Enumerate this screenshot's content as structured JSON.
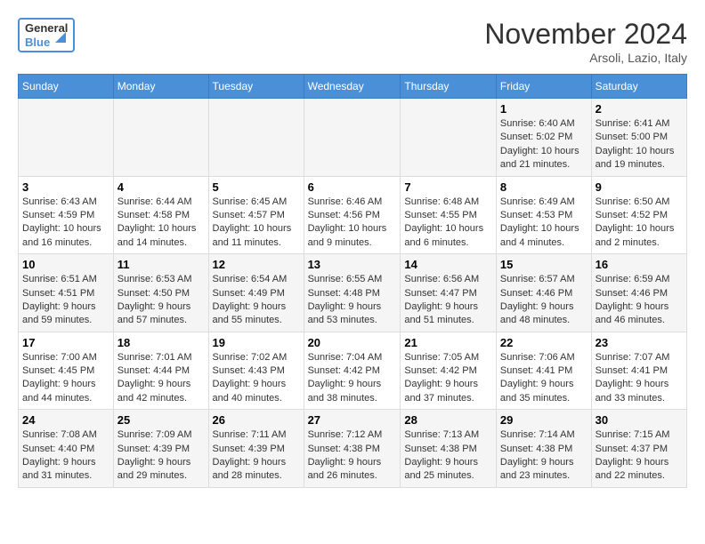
{
  "header": {
    "logo_line1": "General",
    "logo_line2": "Blue",
    "month_title": "November 2024",
    "location": "Arsoli, Lazio, Italy"
  },
  "weekdays": [
    "Sunday",
    "Monday",
    "Tuesday",
    "Wednesday",
    "Thursday",
    "Friday",
    "Saturday"
  ],
  "weeks": [
    [
      {
        "day": "",
        "info": ""
      },
      {
        "day": "",
        "info": ""
      },
      {
        "day": "",
        "info": ""
      },
      {
        "day": "",
        "info": ""
      },
      {
        "day": "",
        "info": ""
      },
      {
        "day": "1",
        "info": "Sunrise: 6:40 AM\nSunset: 5:02 PM\nDaylight: 10 hours and 21 minutes."
      },
      {
        "day": "2",
        "info": "Sunrise: 6:41 AM\nSunset: 5:00 PM\nDaylight: 10 hours and 19 minutes."
      }
    ],
    [
      {
        "day": "3",
        "info": "Sunrise: 6:43 AM\nSunset: 4:59 PM\nDaylight: 10 hours and 16 minutes."
      },
      {
        "day": "4",
        "info": "Sunrise: 6:44 AM\nSunset: 4:58 PM\nDaylight: 10 hours and 14 minutes."
      },
      {
        "day": "5",
        "info": "Sunrise: 6:45 AM\nSunset: 4:57 PM\nDaylight: 10 hours and 11 minutes."
      },
      {
        "day": "6",
        "info": "Sunrise: 6:46 AM\nSunset: 4:56 PM\nDaylight: 10 hours and 9 minutes."
      },
      {
        "day": "7",
        "info": "Sunrise: 6:48 AM\nSunset: 4:55 PM\nDaylight: 10 hours and 6 minutes."
      },
      {
        "day": "8",
        "info": "Sunrise: 6:49 AM\nSunset: 4:53 PM\nDaylight: 10 hours and 4 minutes."
      },
      {
        "day": "9",
        "info": "Sunrise: 6:50 AM\nSunset: 4:52 PM\nDaylight: 10 hours and 2 minutes."
      }
    ],
    [
      {
        "day": "10",
        "info": "Sunrise: 6:51 AM\nSunset: 4:51 PM\nDaylight: 9 hours and 59 minutes."
      },
      {
        "day": "11",
        "info": "Sunrise: 6:53 AM\nSunset: 4:50 PM\nDaylight: 9 hours and 57 minutes."
      },
      {
        "day": "12",
        "info": "Sunrise: 6:54 AM\nSunset: 4:49 PM\nDaylight: 9 hours and 55 minutes."
      },
      {
        "day": "13",
        "info": "Sunrise: 6:55 AM\nSunset: 4:48 PM\nDaylight: 9 hours and 53 minutes."
      },
      {
        "day": "14",
        "info": "Sunrise: 6:56 AM\nSunset: 4:47 PM\nDaylight: 9 hours and 51 minutes."
      },
      {
        "day": "15",
        "info": "Sunrise: 6:57 AM\nSunset: 4:46 PM\nDaylight: 9 hours and 48 minutes."
      },
      {
        "day": "16",
        "info": "Sunrise: 6:59 AM\nSunset: 4:46 PM\nDaylight: 9 hours and 46 minutes."
      }
    ],
    [
      {
        "day": "17",
        "info": "Sunrise: 7:00 AM\nSunset: 4:45 PM\nDaylight: 9 hours and 44 minutes."
      },
      {
        "day": "18",
        "info": "Sunrise: 7:01 AM\nSunset: 4:44 PM\nDaylight: 9 hours and 42 minutes."
      },
      {
        "day": "19",
        "info": "Sunrise: 7:02 AM\nSunset: 4:43 PM\nDaylight: 9 hours and 40 minutes."
      },
      {
        "day": "20",
        "info": "Sunrise: 7:04 AM\nSunset: 4:42 PM\nDaylight: 9 hours and 38 minutes."
      },
      {
        "day": "21",
        "info": "Sunrise: 7:05 AM\nSunset: 4:42 PM\nDaylight: 9 hours and 37 minutes."
      },
      {
        "day": "22",
        "info": "Sunrise: 7:06 AM\nSunset: 4:41 PM\nDaylight: 9 hours and 35 minutes."
      },
      {
        "day": "23",
        "info": "Sunrise: 7:07 AM\nSunset: 4:41 PM\nDaylight: 9 hours and 33 minutes."
      }
    ],
    [
      {
        "day": "24",
        "info": "Sunrise: 7:08 AM\nSunset: 4:40 PM\nDaylight: 9 hours and 31 minutes."
      },
      {
        "day": "25",
        "info": "Sunrise: 7:09 AM\nSunset: 4:39 PM\nDaylight: 9 hours and 29 minutes."
      },
      {
        "day": "26",
        "info": "Sunrise: 7:11 AM\nSunset: 4:39 PM\nDaylight: 9 hours and 28 minutes."
      },
      {
        "day": "27",
        "info": "Sunrise: 7:12 AM\nSunset: 4:38 PM\nDaylight: 9 hours and 26 minutes."
      },
      {
        "day": "28",
        "info": "Sunrise: 7:13 AM\nSunset: 4:38 PM\nDaylight: 9 hours and 25 minutes."
      },
      {
        "day": "29",
        "info": "Sunrise: 7:14 AM\nSunset: 4:38 PM\nDaylight: 9 hours and 23 minutes."
      },
      {
        "day": "30",
        "info": "Sunrise: 7:15 AM\nSunset: 4:37 PM\nDaylight: 9 hours and 22 minutes."
      }
    ]
  ]
}
